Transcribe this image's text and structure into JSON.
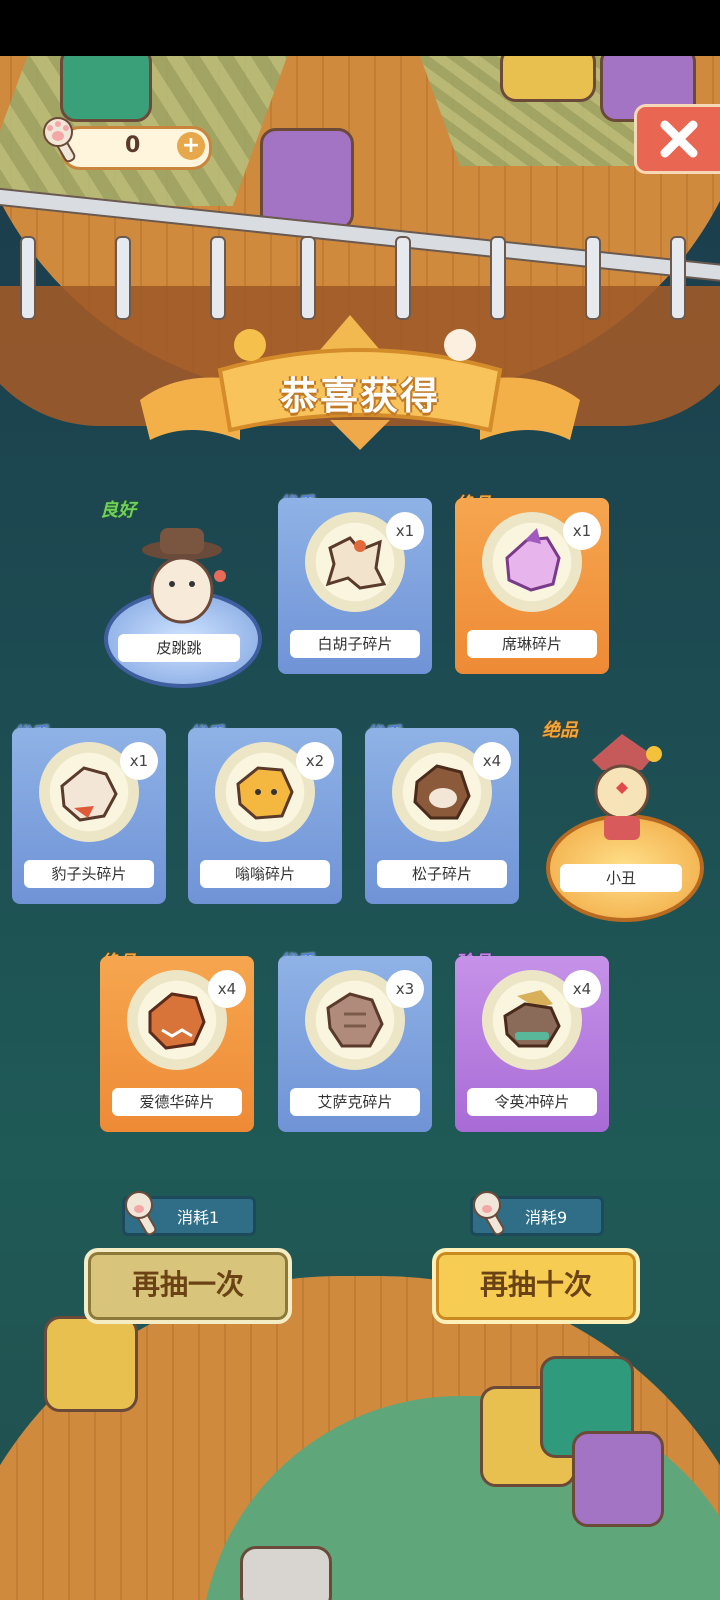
{
  "currency": {
    "amount": "0",
    "plus": "+"
  },
  "banner": {
    "title": "恭喜获得"
  },
  "rewards": [
    {
      "type": "pedestal",
      "rarity": "良好",
      "name": "皮跳跳"
    },
    {
      "type": "card",
      "rarity": "优秀",
      "name": "白胡子碎片",
      "count": "x1"
    },
    {
      "type": "card",
      "rarity": "绝品",
      "name": "席琳碎片",
      "count": "x1"
    },
    {
      "type": "card",
      "rarity": "优秀",
      "name": "豹子头碎片",
      "count": "x1"
    },
    {
      "type": "card",
      "rarity": "优秀",
      "name": "嗡嗡碎片",
      "count": "x2"
    },
    {
      "type": "card",
      "rarity": "优秀",
      "name": "松子碎片",
      "count": "x4"
    },
    {
      "type": "pedestal",
      "rarity": "绝品",
      "name": "小丑"
    },
    {
      "type": "card",
      "rarity": "绝品",
      "name": "爱德华碎片",
      "count": "x4"
    },
    {
      "type": "card",
      "rarity": "优秀",
      "name": "艾萨克碎片",
      "count": "x3"
    },
    {
      "type": "card",
      "rarity": "珍品",
      "name": "令英冲碎片",
      "count": "x4"
    }
  ],
  "draw_once": {
    "cost": "消耗1",
    "label": "再抽一次"
  },
  "draw_ten": {
    "cost": "消耗9",
    "label": "再抽十次"
  }
}
